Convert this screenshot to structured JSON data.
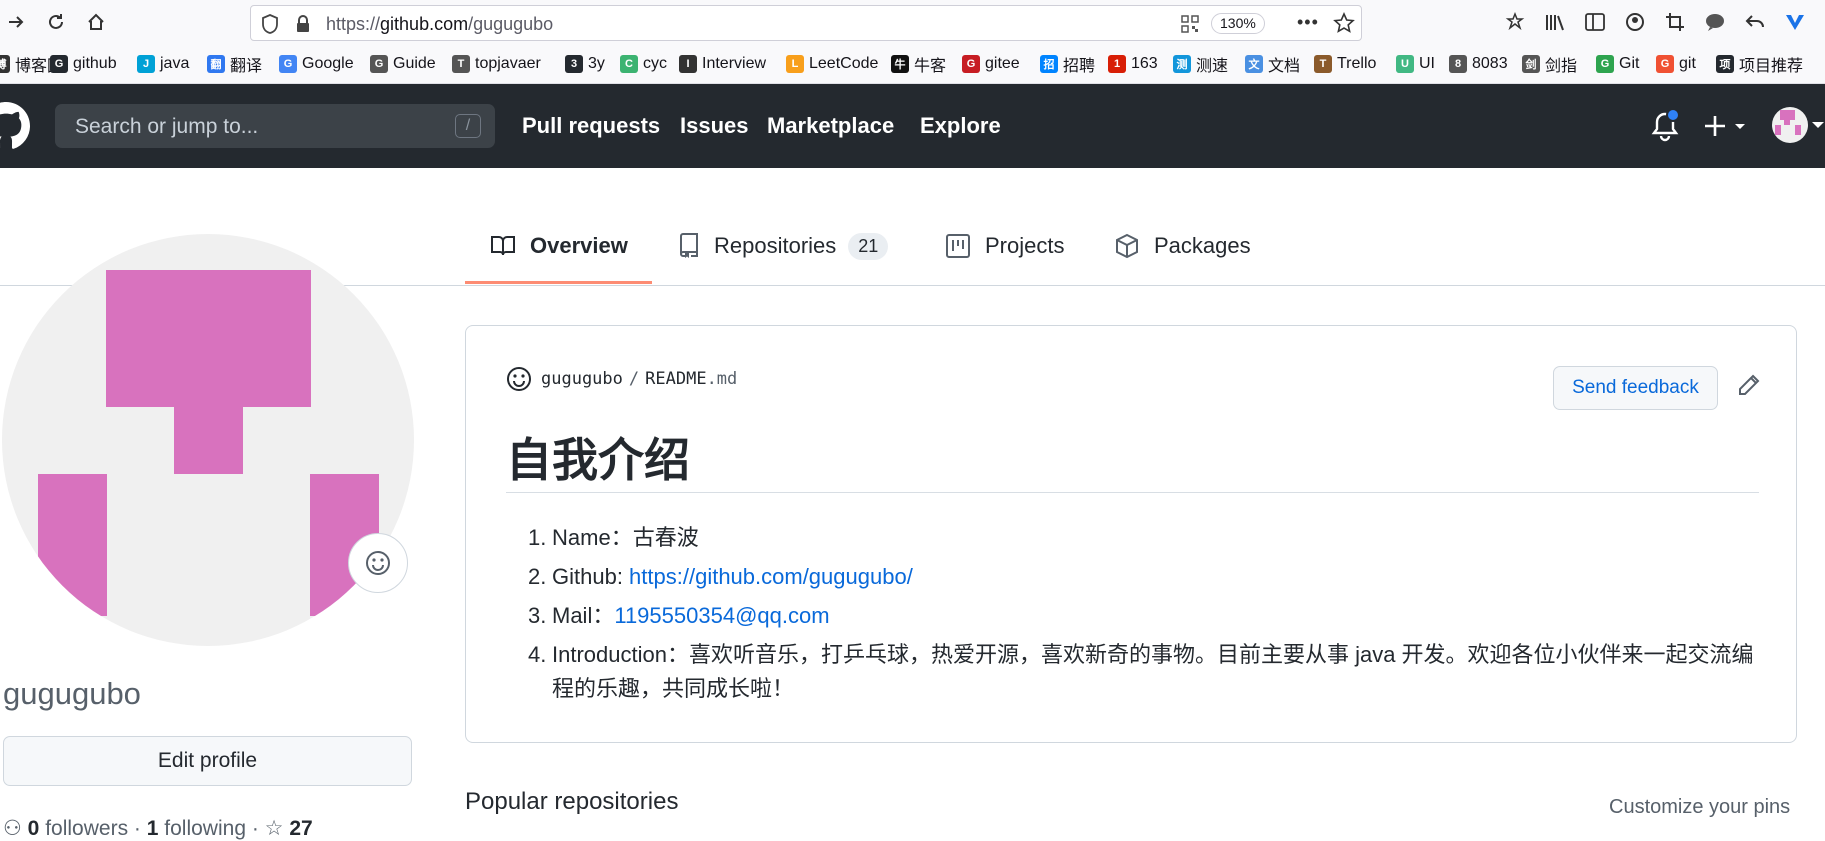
{
  "browser": {
    "url_prefix": "https://",
    "url_host": "github.com",
    "url_path": "/gugugubo",
    "zoom": "130%"
  },
  "bookmarks": [
    {
      "label": "博客园",
      "icon": "blog-icon",
      "color": "#333333"
    },
    {
      "label": "github",
      "icon": "github-icon",
      "color": "#24292f"
    },
    {
      "label": "java",
      "icon": "bilibili-icon",
      "color": "#00a1d6"
    },
    {
      "label": "翻译",
      "icon": "translate-icon",
      "color": "#3078f0"
    },
    {
      "label": "Google",
      "icon": "google-icon",
      "color": "#4285f4"
    },
    {
      "label": "Guide",
      "icon": "globe-icon",
      "color": "#555555"
    },
    {
      "label": "topjavaer",
      "icon": "globe-icon",
      "color": "#555555"
    },
    {
      "label": "3y",
      "icon": "github-icon",
      "color": "#24292f"
    },
    {
      "label": "cyc",
      "icon": "cyc-icon",
      "color": "#3cb371"
    },
    {
      "label": "Interview",
      "icon": "list-icon",
      "color": "#333333"
    },
    {
      "label": "LeetCode",
      "icon": "leetcode-icon",
      "color": "#f89f1b"
    },
    {
      "label": "牛客",
      "icon": "nowcoder-icon",
      "color": "#111111"
    },
    {
      "label": "gitee",
      "icon": "gitee-icon",
      "color": "#c71d23"
    },
    {
      "label": "招聘",
      "icon": "zhihu-icon",
      "color": "#0084ff"
    },
    {
      "label": "163",
      "icon": "netease-icon",
      "color": "#d81e06"
    },
    {
      "label": "测速",
      "icon": "speed-icon",
      "color": "#1296db"
    },
    {
      "label": "文档",
      "icon": "doc-icon",
      "color": "#4a90e2"
    },
    {
      "label": "Trello",
      "icon": "trello-icon",
      "color": "#8b5a2b"
    },
    {
      "label": "UI",
      "icon": "ui-icon",
      "color": "#41b883"
    },
    {
      "label": "8083",
      "icon": "globe-icon",
      "color": "#555555"
    },
    {
      "label": "剑指",
      "icon": "sword-icon",
      "color": "#555555"
    },
    {
      "label": "Git",
      "icon": "git-icon",
      "color": "#2ea44f"
    },
    {
      "label": "git",
      "icon": "git-gear-icon",
      "color": "#f05133"
    },
    {
      "label": "项目推荐",
      "icon": "github-icon",
      "color": "#24292f"
    }
  ],
  "header": {
    "search_placeholder": "Search or jump to...",
    "search_shortcut": "/",
    "nav": [
      "Pull requests",
      "Issues",
      "Marketplace",
      "Explore"
    ]
  },
  "tabs": {
    "overview": "Overview",
    "repositories": "Repositories",
    "repositories_count": "21",
    "projects": "Projects",
    "packages": "Packages"
  },
  "profile": {
    "username": "gugugubo",
    "edit_label": "Edit profile",
    "followers_count": "0",
    "followers_label": "followers",
    "following_count": "1",
    "following_label": "following",
    "stars_count": "27"
  },
  "readme": {
    "owner": "gugugubo",
    "separator": "/",
    "file_name": "README",
    "file_ext": ".md",
    "send_feedback": "Send feedback",
    "title": "自我介绍",
    "items": [
      {
        "num": "1.",
        "label": "Name：",
        "value": "古春波"
      },
      {
        "num": "2.",
        "label": "Github: ",
        "link": "https://github.com/gugugubo/"
      },
      {
        "num": "3.",
        "label": "Mail：",
        "link": "1195550354@qq.com"
      },
      {
        "num": "4.",
        "label": "Introduction：",
        "value": "喜欢听音乐，打乒乓球，热爱开源，喜欢新奇的事物。目前主要从事 java 开发。欢迎各位小伙伴来一起交流编程的乐趣，共同成长啦！"
      }
    ]
  },
  "popular": {
    "heading": "Popular repositories",
    "customize": "Customize your pins"
  },
  "colors": {
    "header_bg": "#24292f",
    "avatar_fill": "#d872be",
    "link": "#0969da",
    "tab_underline": "#fd8c73"
  }
}
